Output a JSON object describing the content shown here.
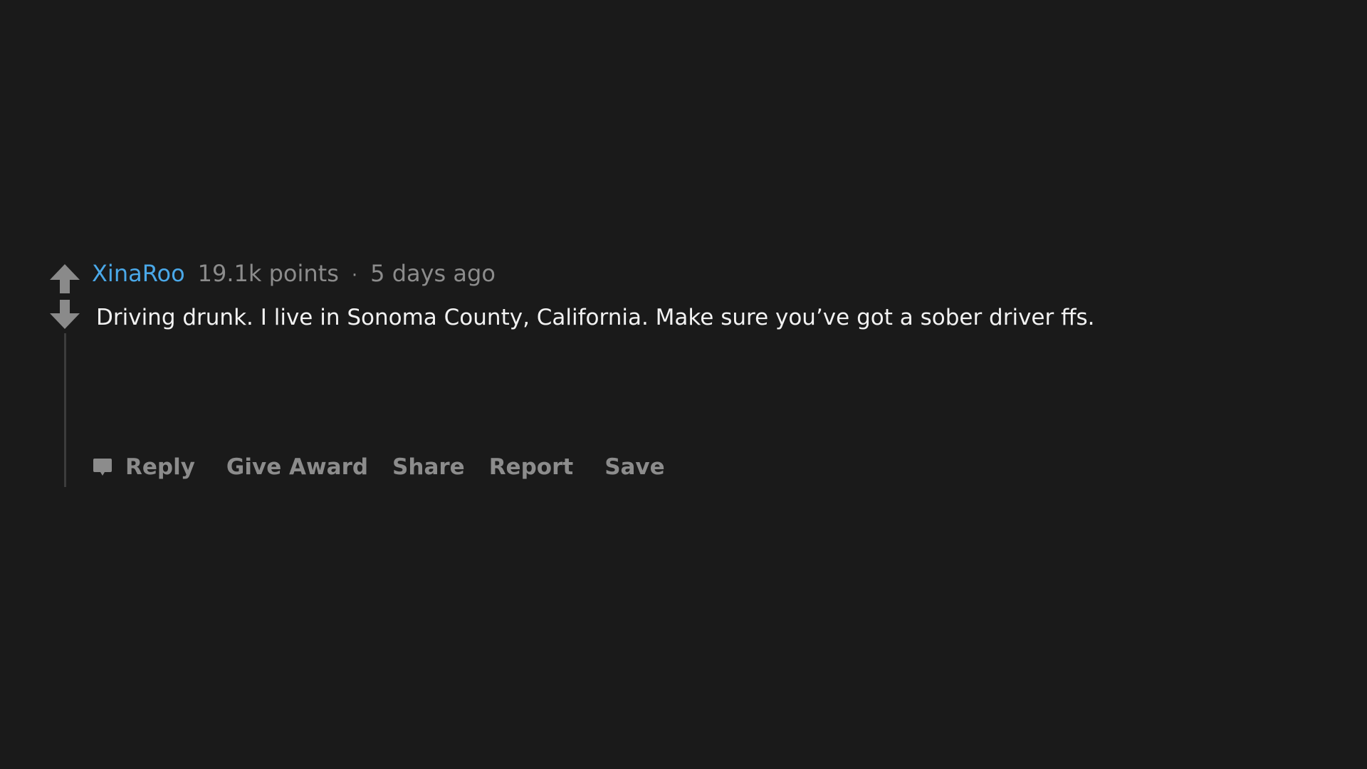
{
  "comment": {
    "author": "XinaRoo",
    "score": "19.1k points",
    "separator": "·",
    "time": "5 days ago",
    "body": "Driving drunk. I live in Sonoma County, California. Make sure you’ve got a sober driver ffs."
  },
  "actions": {
    "reply": "Reply",
    "give_award": "Give Award",
    "share": "Share",
    "report": "Report",
    "save": "Save"
  },
  "icons": {
    "upvote": "upvote-arrow-icon",
    "downvote": "downvote-arrow-icon",
    "reply": "speech-bubble-icon"
  },
  "colors": {
    "background": "#1a1a1a",
    "author": "#4aa8e8",
    "meta": "#8c8c8c",
    "body": "#f2f2f2",
    "vote_arrow": "#8a8a8a",
    "thread_line": "#3c3c3c"
  }
}
